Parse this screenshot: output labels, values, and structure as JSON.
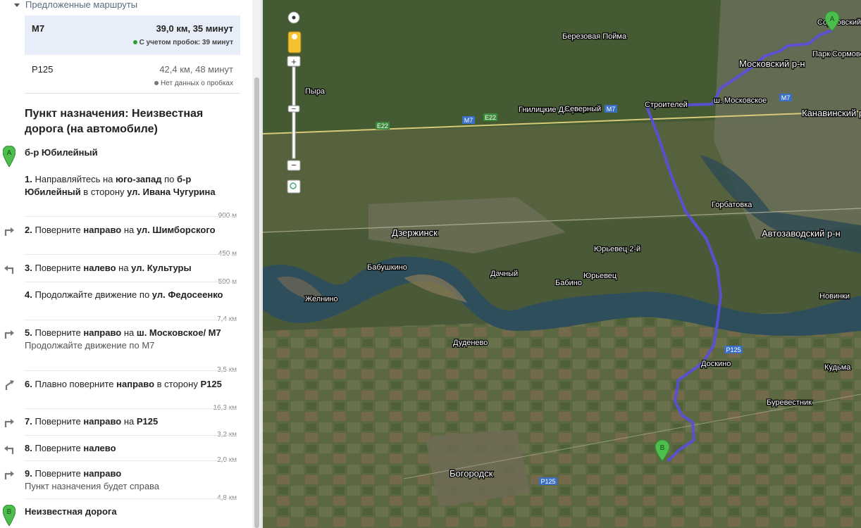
{
  "sidebar": {
    "section_title": "Предложенные маршруты",
    "routes": [
      {
        "name": "M7",
        "distance_time": "39,0 км, 35 минут",
        "traffic": "С учетом пробок: 39 минут",
        "traffic_color": "#2e9e2e"
      },
      {
        "name": "P125",
        "distance_time": "42,4 км, 48 минут",
        "traffic": "Нет данных о пробках",
        "traffic_color": "#777777"
      }
    ],
    "destination_title": "Пункт назначения: Неизвестная дорога (на автомобиле)",
    "start": {
      "marker": "A",
      "label": "б-р Юбилейный"
    },
    "end": {
      "marker": "B",
      "label": "Неизвестная дорога"
    },
    "steps": [
      {
        "num": "1.",
        "turn_icon": "straight-icon",
        "parts": [
          "Направляйтесь на ",
          "юго-запад",
          " по ",
          "б-р Юбилейный",
          " в сторону ",
          "ул. Ивана Чугурина"
        ],
        "sub": "",
        "distance": "900 м"
      },
      {
        "num": "2.",
        "turn_icon": "turn-right-icon",
        "parts": [
          "Поверните ",
          "направо",
          " на ",
          "ул. Шимборского"
        ],
        "sub": "",
        "distance": "450 м"
      },
      {
        "num": "3.",
        "turn_icon": "turn-left-icon",
        "parts": [
          "Поверните ",
          "налево",
          " на ",
          "ул. Культуры"
        ],
        "sub": "",
        "distance": "500 м"
      },
      {
        "num": "4.",
        "turn_icon": "straight-icon",
        "parts": [
          "Продолжайте движение по ",
          "ул. Федосеенко"
        ],
        "sub": "",
        "distance": "7,4 км"
      },
      {
        "num": "5.",
        "turn_icon": "turn-right-icon",
        "parts": [
          "Поверните ",
          "направо",
          " на ",
          "ш. Московское/ M7"
        ],
        "sub": "Продолжайте движение по M7",
        "distance": "3,5 км"
      },
      {
        "num": "6.",
        "turn_icon": "slight-right-icon",
        "parts": [
          "Плавно поверните ",
          "направо",
          " в сторону ",
          "P125"
        ],
        "sub": "",
        "distance": "16,3 км"
      },
      {
        "num": "7.",
        "turn_icon": "turn-right-icon",
        "parts": [
          "Поверните ",
          "направо",
          " на ",
          "P125"
        ],
        "sub": "",
        "distance": "3,2 км"
      },
      {
        "num": "8.",
        "turn_icon": "turn-left-icon",
        "parts": [
          "Поверните ",
          "налево"
        ],
        "sub": "",
        "distance": "2,0 км"
      },
      {
        "num": "9.",
        "turn_icon": "turn-right-icon",
        "parts": [
          "Поверните ",
          "направо"
        ],
        "sub": "Пункт назначения будет справа",
        "distance": "4,8 км"
      }
    ]
  },
  "map": {
    "route_color": "#5a4fe0",
    "labels": {
      "sormovsky": "Сормовский р-н",
      "park": "Парк Сормовский",
      "moskovsky": "Московский р-н",
      "kanavinsky": "Канавинский р-н",
      "berezovaya": "Березовая Пойма",
      "pyra": "Пыра",
      "gnilitskie": "Гнилицкие Дворики",
      "severny": "Северный",
      "stroiteley": "Строителей",
      "sh_moskovskoe": "ш. Московское",
      "gorbatovka": "Горбатовка",
      "dzerzhinsk": "Дзержинск",
      "avtozavodsky": "Автозаводский р-н",
      "yurievets2": "Юрьевец 2-й",
      "yurievets": "Юрьевец",
      "babushkino": "Бабушкино",
      "dachny": "Дачный",
      "babino": "Бабино",
      "zhelnino": "Желнино",
      "novinki": "Новинки",
      "dudenevo": "Дуденево",
      "doskino": "Доскино",
      "kudma": "Кудьма",
      "burevestnik": "Буревестник",
      "bogorodsk": "Богородск"
    },
    "shields": {
      "m7": "M7",
      "e22": "E22",
      "p125": "P125"
    },
    "markers": {
      "a": "A",
      "b": "B"
    },
    "controls": {
      "zoom_in": "+",
      "zoom_out": "−"
    }
  }
}
